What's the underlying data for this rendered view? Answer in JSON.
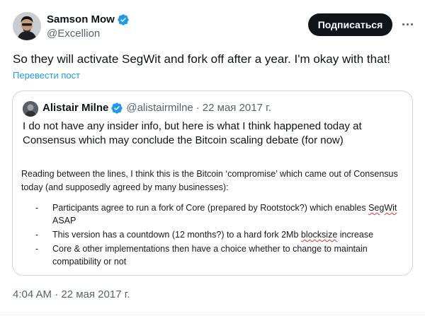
{
  "tweet": {
    "author_name": "Samson Mow",
    "author_handle": "@Excellion",
    "subscribe_label": "Подписаться",
    "text": "So they will activate SegWit and fork off after a year. I'm okay with that!",
    "translate_label": "Перевести пост",
    "timestamp": "4:04 AM · 22 мая 2017 г."
  },
  "quote": {
    "author_name": "Alistair Milne",
    "author_handle": "@alistairmilne",
    "separator": "·",
    "date": "22 мая 2017 г.",
    "text": "I do not have any insider info, but here is what I think happened today at Consensus which may conclude the Bitcoin scaling debate (for now)",
    "image": {
      "intro": "Reading between the lines, I think this is the Bitcoin ‘compromise’ which came out of Consensus today (and supposedly agreed by many businesses):",
      "bullets": [
        {
          "dash": "-",
          "before": "Participants agree to run a fork of Core (prepared by Rootstock?) which enables ",
          "marked": "SegWit",
          "after": " ASAP"
        },
        {
          "dash": "-",
          "before": "This version has a countdown (12 months?) to a hard fork 2Mb ",
          "marked": "blocksize",
          "after": " increase"
        },
        {
          "dash": "-",
          "before": "Core & other implementations then have a choice whether to change to maintain compatibility or not",
          "marked": "",
          "after": ""
        }
      ]
    }
  },
  "colors": {
    "accent": "#1d9bf0",
    "text_primary": "#0f1419",
    "text_secondary": "#536471",
    "button_bg": "#0f1419",
    "border": "#cfd9de"
  },
  "icons": {
    "verified": "verified-badge-icon",
    "more": "more-dots-icon"
  }
}
